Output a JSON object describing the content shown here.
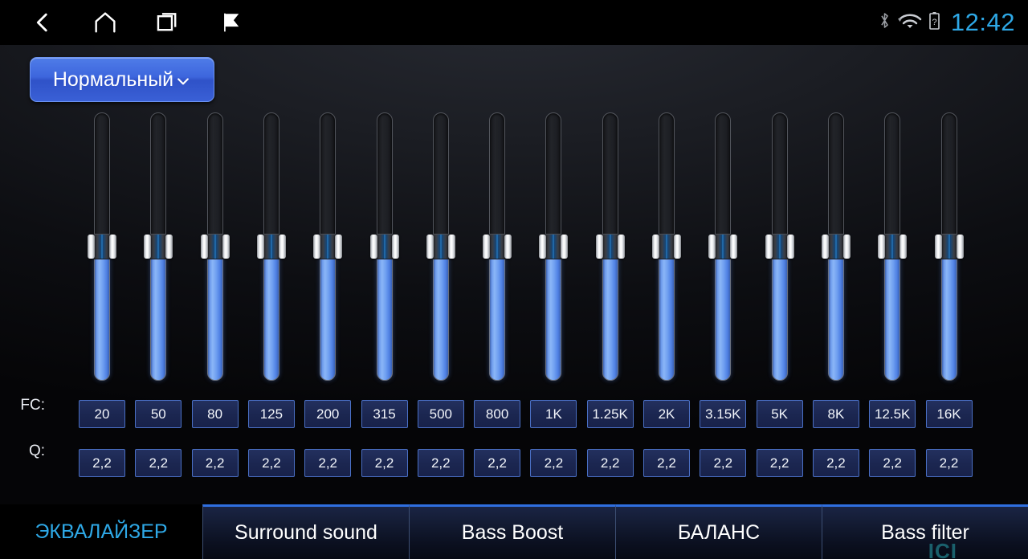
{
  "statusbar": {
    "nav": [
      {
        "name": "back-icon",
        "label": "Back"
      },
      {
        "name": "home-icon",
        "label": "Home"
      },
      {
        "name": "recents-icon",
        "label": "Recent apps"
      },
      {
        "name": "flag-icon",
        "label": "Flag"
      }
    ],
    "icons": [
      {
        "name": "bluetooth-icon",
        "label": "Bluetooth"
      },
      {
        "name": "wifi-icon",
        "label": "Wi-Fi"
      },
      {
        "name": "battery-unknown-icon",
        "label": "Battery"
      }
    ],
    "clock": "12:42",
    "clock_color": "#2ea8e6"
  },
  "preset": {
    "label": "Нормальный",
    "caret": "chevron-down-icon"
  },
  "equalizer": {
    "fc_row_label": "FC:",
    "q_row_label": "Q:",
    "bands": [
      {
        "fc": "20",
        "q": "2,2"
      },
      {
        "fc": "50",
        "q": "2,2"
      },
      {
        "fc": "80",
        "q": "2,2"
      },
      {
        "fc": "125",
        "q": "2,2"
      },
      {
        "fc": "200",
        "q": "2,2"
      },
      {
        "fc": "315",
        "q": "2,2"
      },
      {
        "fc": "500",
        "q": "2,2"
      },
      {
        "fc": "800",
        "q": "2,2"
      },
      {
        "fc": "1K",
        "q": "2,2"
      },
      {
        "fc": "1.25K",
        "q": "2,2"
      },
      {
        "fc": "2K",
        "q": "2,2"
      },
      {
        "fc": "3.15K",
        "q": "2,2"
      },
      {
        "fc": "5K",
        "q": "2,2"
      },
      {
        "fc": "8K",
        "q": "2,2"
      },
      {
        "fc": "12.5K",
        "q": "2,2"
      },
      {
        "fc": "16K",
        "q": "2,2"
      }
    ],
    "slider_levels": [
      50,
      50,
      50,
      50,
      50,
      50,
      50,
      50,
      50,
      50,
      50,
      50,
      50,
      50,
      50,
      50
    ],
    "accent_color": "#7aa8f2",
    "box_border_color": "#4a6fc4"
  },
  "tabs": [
    {
      "label": "ЭКВАЛАЙЗЕР",
      "active": true
    },
    {
      "label": "Surround sound",
      "active": false
    },
    {
      "label": "Bass Boost",
      "active": false
    },
    {
      "label": "БАЛАНС",
      "active": false
    },
    {
      "label": "Bass filter",
      "active": false
    }
  ],
  "watermark": "ICI"
}
